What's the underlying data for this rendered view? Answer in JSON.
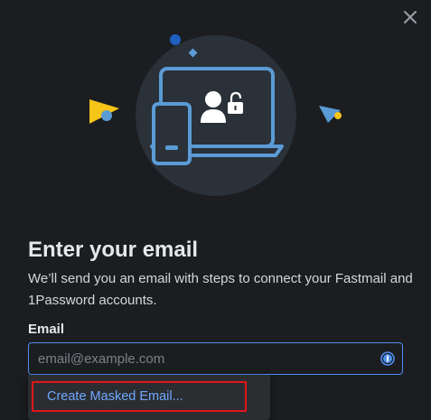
{
  "dialog": {
    "title": "Enter your email",
    "description": "We’ll send you an email with steps to connect your Fastmail and 1Password accounts.",
    "email_label": "Email",
    "email_placeholder": "email@example.com",
    "email_value": "",
    "close_icon": "close-icon",
    "password_manager_icon": "1password-icon"
  },
  "autofill_menu": {
    "items": [
      {
        "label": "Create Masked Email..."
      }
    ]
  },
  "colors": {
    "background": "#1b1d20",
    "accent": "#4f8ff0",
    "link": "#6fa8ff",
    "highlight_border": "#e0161b",
    "illustration_circle": "#2a3139",
    "illustration_stroke": "#5b9bd5",
    "yellow": "#f5c518"
  }
}
